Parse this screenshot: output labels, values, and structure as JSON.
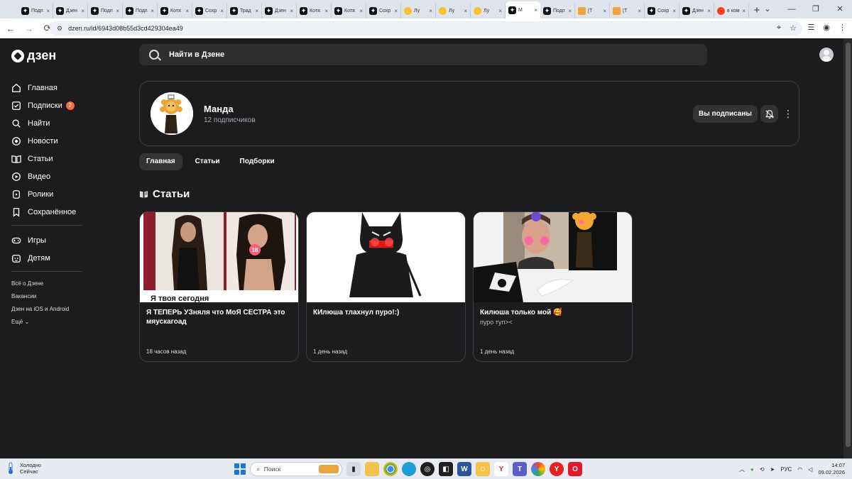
{
  "browser": {
    "tabs": [
      {
        "title": "Подп",
        "icon": "zen"
      },
      {
        "title": "Дзен",
        "icon": "zen"
      },
      {
        "title": "Подп",
        "icon": "zen"
      },
      {
        "title": "Подп",
        "icon": "zen"
      },
      {
        "title": "Котя",
        "icon": "zen"
      },
      {
        "title": "Сохр",
        "icon": "zen"
      },
      {
        "title": "Трад",
        "icon": "zen"
      },
      {
        "title": "Дзен",
        "icon": "zen"
      },
      {
        "title": "Котя",
        "icon": "zen"
      },
      {
        "title": "Котя",
        "icon": "zen"
      },
      {
        "title": "Сохр",
        "icon": "zen"
      },
      {
        "title": "Лу",
        "icon": "sun"
      },
      {
        "title": "Лу",
        "icon": "sun"
      },
      {
        "title": "Лу",
        "icon": "sun"
      },
      {
        "title": "М",
        "icon": "zen",
        "active": true
      },
      {
        "title": "Подп",
        "icon": "zen"
      },
      {
        "title": "[Т",
        "icon": "hand"
      },
      {
        "title": "[Т",
        "icon": "hand"
      },
      {
        "title": "Сохр",
        "icon": "zen"
      },
      {
        "title": "Дзен",
        "icon": "zen"
      },
      {
        "title": "в ком",
        "icon": "ya"
      }
    ],
    "url": "dzen.ru/id/6943d08b55d3cd429304ea49"
  },
  "header": {
    "logo": "дзен",
    "search_placeholder": "Найти в Дзене"
  },
  "sidebar": {
    "items": [
      {
        "label": "Главная",
        "icon": "home-icon"
      },
      {
        "label": "Подписки",
        "icon": "subscriptions-icon",
        "badge": "2"
      },
      {
        "label": "Найти",
        "icon": "search-icon"
      },
      {
        "label": "Новости",
        "icon": "news-icon"
      },
      {
        "label": "Статьи",
        "icon": "articles-icon"
      },
      {
        "label": "Видео",
        "icon": "video-icon"
      },
      {
        "label": "Ролики",
        "icon": "shorts-icon"
      },
      {
        "label": "Сохранённое",
        "icon": "bookmark-icon"
      }
    ],
    "items2": [
      {
        "label": "Игры",
        "icon": "gamepad-icon"
      },
      {
        "label": "Детям",
        "icon": "kids-icon"
      }
    ],
    "footer": [
      "Всё о Дзене",
      "Вакансии",
      "Дзен на iOS и Android",
      "Ещё"
    ]
  },
  "channel": {
    "name": "Манда",
    "subscribers": "12 подписчиков",
    "subscribe_label": "Вы подписаны"
  },
  "tabs": [
    "Главная",
    "Статьи",
    "Подборки"
  ],
  "section_title": "Статьи",
  "cards": [
    {
      "title": "Я ТЕПЕРЬ УЗняля что МоЯ СЕСТРА это мяускагоад",
      "subtitle": "",
      "date": "18 часов назад",
      "thumb_text": "Я твоя сегодня"
    },
    {
      "title": "КИлюша тлахнул пуро!:)",
      "subtitle": "",
      "date": "1 день назад"
    },
    {
      "title": "Килюша только мой 🥰",
      "subtitle": "пуро туп><",
      "date": "1 день назад"
    }
  ],
  "taskbar": {
    "weather_title": "Холодно",
    "weather_sub": "Сейчас",
    "search_placeholder": "Поиск",
    "lang": "РУС",
    "time": "14:07",
    "date": "09.02.2026"
  }
}
